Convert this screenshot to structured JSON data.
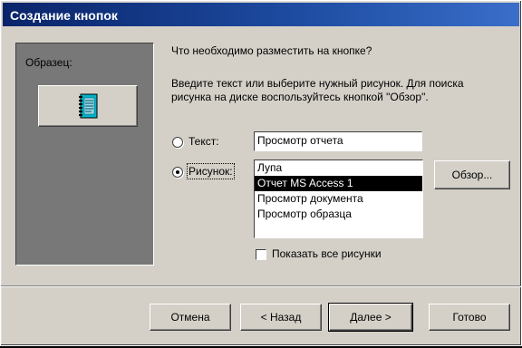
{
  "window": {
    "title": "Создание кнопок"
  },
  "sample": {
    "label": "Образец:",
    "icon": "report-icon"
  },
  "question": "Что необходимо разместить на кнопке?",
  "instructions": {
    "line1": "Введите текст или выберите нужный рисунок.  Для поиска",
    "line2": "рисунка на диске воспользуйтесь кнопкой \"Обзор\"."
  },
  "text_option": {
    "label": "Текст:",
    "selected": false,
    "value": "Просмотр отчета"
  },
  "picture_option": {
    "label": "Рисунок:",
    "selected": true
  },
  "picture_list": {
    "items": [
      "Лупа",
      "Отчет MS Access 1",
      "Просмотр документа",
      "Просмотр образца"
    ],
    "selected_index": 1
  },
  "browse_button": "Обзор...",
  "show_all_pictures": {
    "label": "Показать все рисунки",
    "checked": false
  },
  "footer": {
    "cancel": "Отмена",
    "back": "< Назад",
    "next": "Далее >",
    "finish": "Готово"
  },
  "colors": {
    "titlebar": "#0a246a",
    "selection": "#000000",
    "sample_panel": "#787878"
  }
}
